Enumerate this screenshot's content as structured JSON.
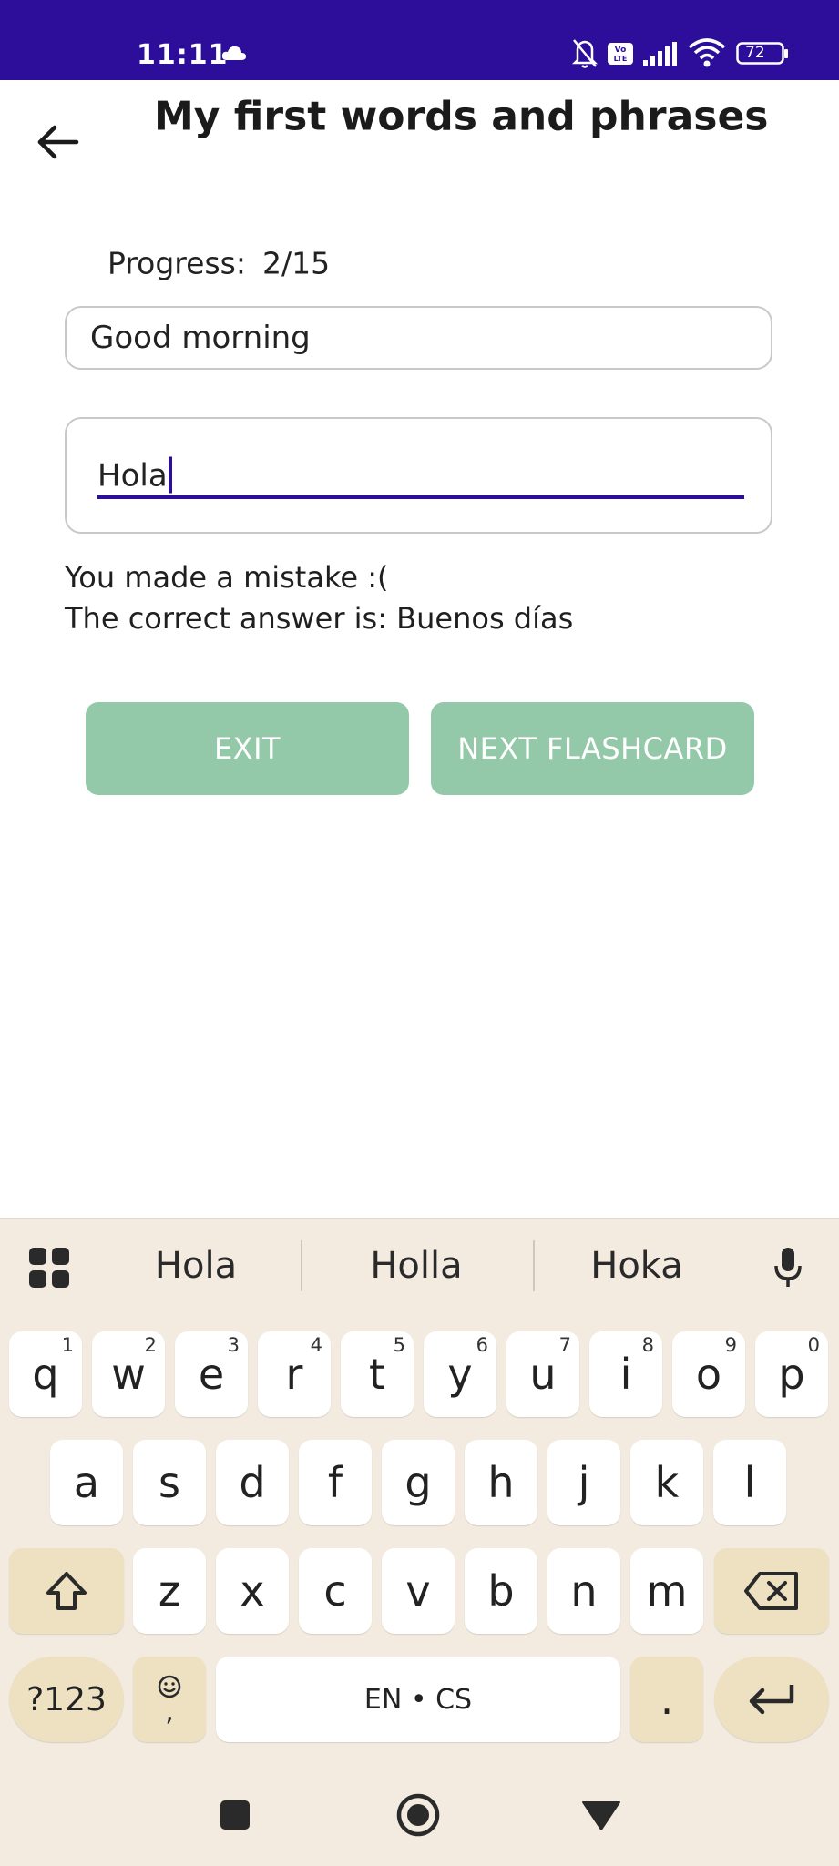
{
  "status_bar": {
    "time": "11:11",
    "battery": "72",
    "color": "#2c0e9b"
  },
  "app_bar": {
    "title": "My first words and phrases"
  },
  "progress": {
    "label": "Progress:",
    "value": "2/15"
  },
  "flashcard": {
    "prompt": "Good morning",
    "answer_input": "Hola"
  },
  "feedback": {
    "line1": "You made a mistake :(",
    "line2": "The correct answer is: Buenos días"
  },
  "buttons": {
    "exit": "EXIT",
    "next": "NEXT FLASHCARD",
    "color": "#93c9a9"
  },
  "keyboard": {
    "suggestions": [
      "Hola",
      "Holla",
      "Hoka"
    ],
    "row1": [
      "q",
      "w",
      "e",
      "r",
      "t",
      "y",
      "u",
      "i",
      "o",
      "p"
    ],
    "row1_hints": [
      "1",
      "2",
      "3",
      "4",
      "5",
      "6",
      "7",
      "8",
      "9",
      "0"
    ],
    "row2": [
      "a",
      "s",
      "d",
      "f",
      "g",
      "h",
      "j",
      "k",
      "l"
    ],
    "row3": [
      "z",
      "x",
      "c",
      "v",
      "b",
      "n",
      "m"
    ],
    "symbols_key": "?123",
    "space_label": "EN • CS",
    "period_key": ".",
    "emoji_comma": ","
  }
}
